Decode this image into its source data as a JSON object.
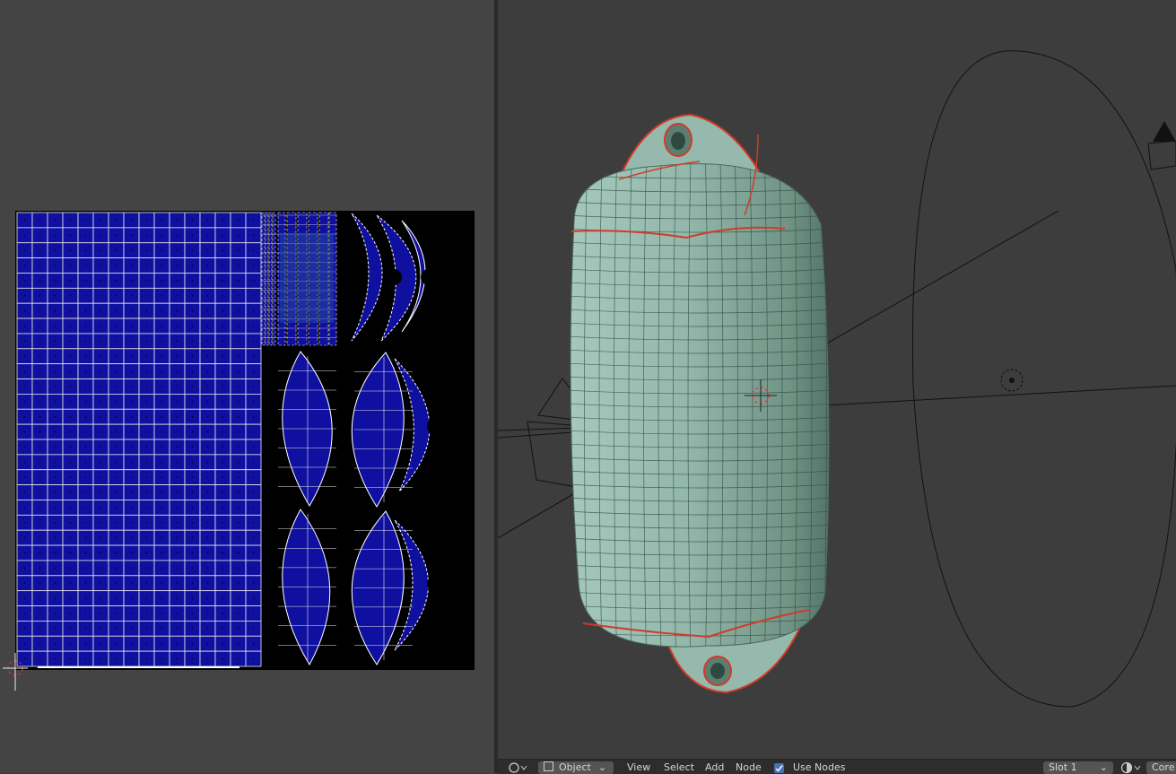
{
  "colors": {
    "uv_background": "#444444",
    "uv_canvas": "#000000",
    "uv_face": "#0f0fa0",
    "viewport_background": "#3d3d3d",
    "mesh_color": "#8fb5a8",
    "seam_color": "#d23a2a",
    "header_background": "#2d2d2d",
    "accent": "#4772b3"
  },
  "uv_editor": {
    "cursor_icon": "2d-cursor-icon",
    "grid_cols": 16,
    "grid_rows": 30
  },
  "viewport": {
    "objects": [
      "fender-mesh",
      "camera",
      "light",
      "empty-circle",
      "3d-cursor"
    ]
  },
  "header": {
    "editor_type_icon": "node-editor-icon",
    "object_dropdown": "Object",
    "menus": [
      "View",
      "Select",
      "Add",
      "Node"
    ],
    "use_nodes_label": "Use Nodes",
    "use_nodes_checked": true,
    "slot_dropdown": "Slot 1",
    "shading_icon": "material-sphere-icon",
    "right_label": "Core"
  }
}
